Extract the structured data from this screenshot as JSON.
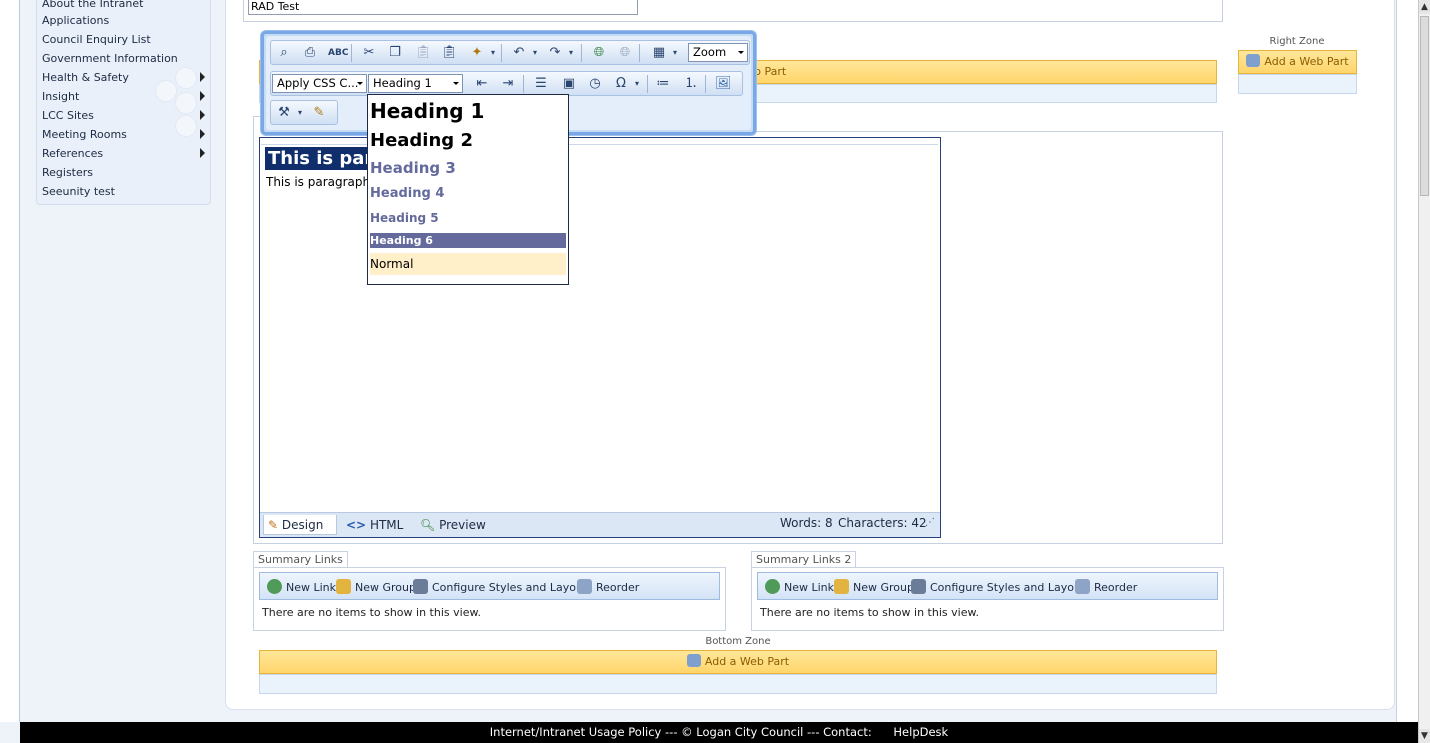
{
  "nav": {
    "items": [
      {
        "label": "About the Intranet"
      },
      {
        "label": "Applications"
      },
      {
        "label": "Council Enquiry List"
      },
      {
        "label": "Government Information"
      },
      {
        "label": "Health & Safety"
      },
      {
        "label": "Insight"
      },
      {
        "label": "LCC Sites"
      },
      {
        "label": "Meeting Rooms"
      },
      {
        "label": "References"
      },
      {
        "label": "Registers"
      },
      {
        "label": "Seeunity test"
      }
    ]
  },
  "page": {
    "title_value": "RAD Test"
  },
  "zones": {
    "right_label": "Right Zone",
    "bottom_label": "Bottom Zone",
    "add_web_part": "Add a Web Part",
    "top_add_partial": "b Part"
  },
  "toolbar": {
    "zoom_label": "Zoom",
    "css_label": "Apply CSS C...",
    "heading_label": "Heading 1"
  },
  "heading_options": [
    "Heading 1",
    "Heading 2",
    "Heading 3",
    "Heading 4",
    "Heading 5",
    "Heading 6",
    "Normal"
  ],
  "editor": {
    "content_heading": "This is para",
    "content_paragraph": "This is paragraph",
    "mode_design": "Design",
    "mode_html": "HTML",
    "mode_preview": "Preview",
    "words": "Words: 8",
    "characters": "Characters: 42"
  },
  "summary_links": [
    {
      "title": "Summary Links",
      "actions": [
        "New Link",
        "New Group",
        "Configure Styles and Layout",
        "Reorder"
      ],
      "empty_text": "There are no items to show in this view."
    },
    {
      "title": "Summary Links 2",
      "actions": [
        "New Link",
        "New Group",
        "Configure Styles and Layout",
        "Reorder"
      ],
      "empty_text": "There are no items to show in this view."
    }
  ],
  "footer": {
    "text": "Internet/Intranet Usage Policy --- © Logan City Council --- Contact:",
    "helpdesk": "HelpDesk"
  },
  "colors": {
    "accent": "#7aa7e6",
    "selected_heading": "#0f2e6b",
    "web_part_bar": "#ffd56b",
    "footer_bg": "#000000"
  }
}
